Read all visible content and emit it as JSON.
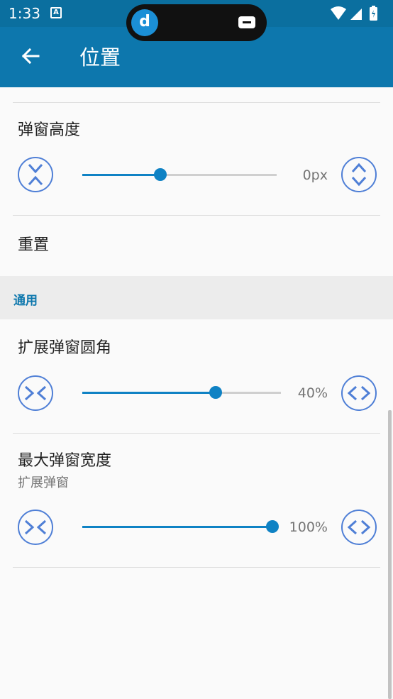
{
  "status_bar": {
    "time": "1:33",
    "notification_icon_letter": "A",
    "icons": [
      "wifi-icon",
      "signal-icon",
      "battery-icon"
    ]
  },
  "app_bar": {
    "title": "位置",
    "back_icon": "arrow-left-icon"
  },
  "settings": {
    "popup_height": {
      "title": "弹窗高度",
      "value": "0px",
      "slider_fraction": 0.4,
      "decrease_icon": "compress-vertical-icon",
      "increase_icon": "expand-vertical-icon"
    },
    "reset": {
      "title": "重置"
    }
  },
  "section": {
    "label": "通用"
  },
  "general": {
    "corner_radius": {
      "title": "扩展弹窗圆角",
      "value": "40%",
      "slider_fraction": 0.67,
      "decrease_icon": "compress-horizontal-icon",
      "increase_icon": "expand-horizontal-icon"
    },
    "max_width": {
      "title": "最大弹窗宽度",
      "subtitle": "扩展弹窗",
      "value": "100%",
      "slider_fraction": 1.0,
      "decrease_icon": "compress-horizontal-icon",
      "increase_icon": "expand-horizontal-icon"
    }
  },
  "colors": {
    "app_bar": "#0d77ad",
    "accent": "#0f82c4",
    "button_outline": "#4f7fd6"
  }
}
